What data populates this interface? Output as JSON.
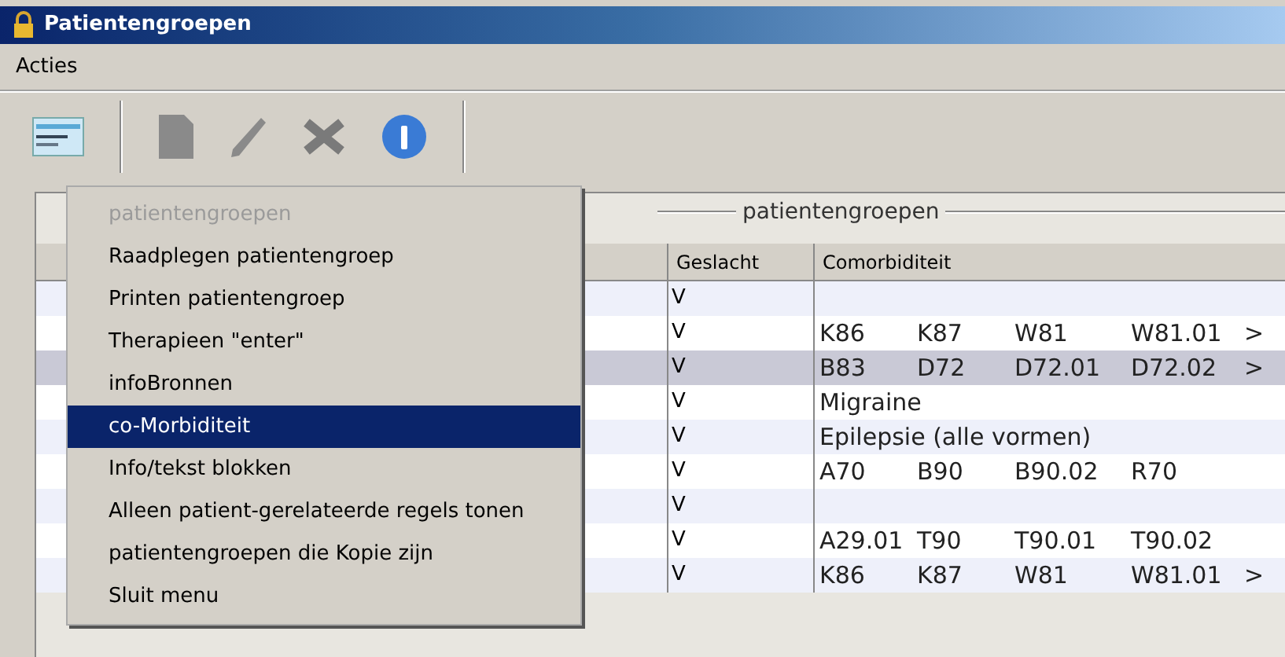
{
  "window": {
    "title": "Patientengroepen"
  },
  "menu_bar": [
    "Acties"
  ],
  "toolbar": [
    {
      "kind": "card",
      "disabled": false
    },
    {
      "kind": "document",
      "disabled": true
    },
    {
      "kind": "pencil",
      "disabled": true
    },
    {
      "kind": "cross",
      "disabled": true
    },
    {
      "kind": "info",
      "disabled": false
    }
  ],
  "group": {
    "title": "patientengroepen"
  },
  "table": {
    "columns": [
      "Geslacht",
      "Comorbiditeit"
    ],
    "rows": [
      {
        "geslacht": "V",
        "codes": [],
        "selected": false
      },
      {
        "geslacht": "V",
        "codes": [
          "K86",
          "K87",
          "W81",
          "W81.01"
        ],
        "more": ">",
        "selected": false
      },
      {
        "geslacht": "V",
        "codes": [
          "B83",
          "D72",
          "D72.01",
          "D72.02"
        ],
        "more": ">",
        "selected": true
      },
      {
        "geslacht": "V",
        "text": "Migraine",
        "codes": [],
        "selected": false
      },
      {
        "geslacht": "V",
        "text": "Epilepsie (alle vormen)",
        "codes": [],
        "selected": false
      },
      {
        "geslacht": "V",
        "codes": [
          "A70",
          "B90",
          "B90.02",
          "R70"
        ],
        "selected": false
      },
      {
        "geslacht": "V",
        "codes": [],
        "selected": false
      },
      {
        "geslacht": "V",
        "codes": [
          "A29.01",
          "T90",
          "T90.01",
          "T90.02"
        ],
        "selected": false
      },
      {
        "geslacht": "V",
        "codes": [
          "K86",
          "K87",
          "W81",
          "W81.01"
        ],
        "more": ">",
        "selected": false
      }
    ]
  },
  "context_menu": [
    {
      "label": "patientengroepen",
      "disabled": true,
      "selected": false
    },
    {
      "label": "Raadplegen patientengroep",
      "disabled": false,
      "selected": false
    },
    {
      "label": "Printen patientengroep",
      "disabled": false,
      "selected": false
    },
    {
      "label": "Therapieen \"enter\"",
      "disabled": false,
      "selected": false
    },
    {
      "label": "infoBronnen",
      "disabled": false,
      "selected": false
    },
    {
      "label": "co-Morbiditeit",
      "disabled": false,
      "selected": true
    },
    {
      "label": "Info/tekst blokken",
      "disabled": false,
      "selected": false
    },
    {
      "label": "Alleen patient-gerelateerde regels tonen",
      "disabled": false,
      "selected": false
    },
    {
      "label": "patientengroepen die Kopie zijn",
      "disabled": false,
      "selected": false
    },
    {
      "label": "Sluit menu",
      "disabled": false,
      "selected": false
    }
  ]
}
